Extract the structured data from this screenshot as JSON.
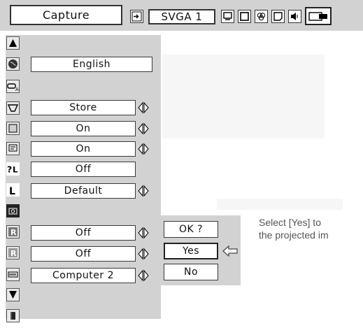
{
  "toolbar": {
    "title": "Capture",
    "source_label": "SVGA 1",
    "icons": [
      "input-icon",
      "image-icon",
      "screen-icon",
      "color-icon",
      "setting-icon",
      "sound-icon",
      "video-icon"
    ]
  },
  "menu_items": [
    {
      "icon": "arrow-up-icon",
      "value": ""
    },
    {
      "icon": "language-icon",
      "value": "English"
    },
    {
      "icon": "auto-setup-icon",
      "value": ""
    },
    {
      "icon": "keystone-icon",
      "value": "Store"
    },
    {
      "icon": "blue-back-icon",
      "value": "On"
    },
    {
      "icon": "display-icon",
      "value": "On"
    },
    {
      "icon": "logo-icon",
      "value": "Off"
    },
    {
      "icon": "logo-select-icon",
      "value": "Default"
    },
    {
      "icon": "capture-icon",
      "value": ""
    },
    {
      "icon": "ceiling-icon",
      "value": "Off"
    },
    {
      "icon": "rear-icon",
      "value": "Off"
    },
    {
      "icon": "terminal-icon",
      "value": "Computer 2"
    },
    {
      "icon": "arrow-down-icon",
      "value": ""
    },
    {
      "icon": "exit-icon",
      "value": ""
    }
  ],
  "dialog": {
    "question": "OK ?",
    "yes": "Yes",
    "no": "No"
  },
  "hint": {
    "line1": "Select [Yes] to",
    "line2": "the projected im"
  }
}
